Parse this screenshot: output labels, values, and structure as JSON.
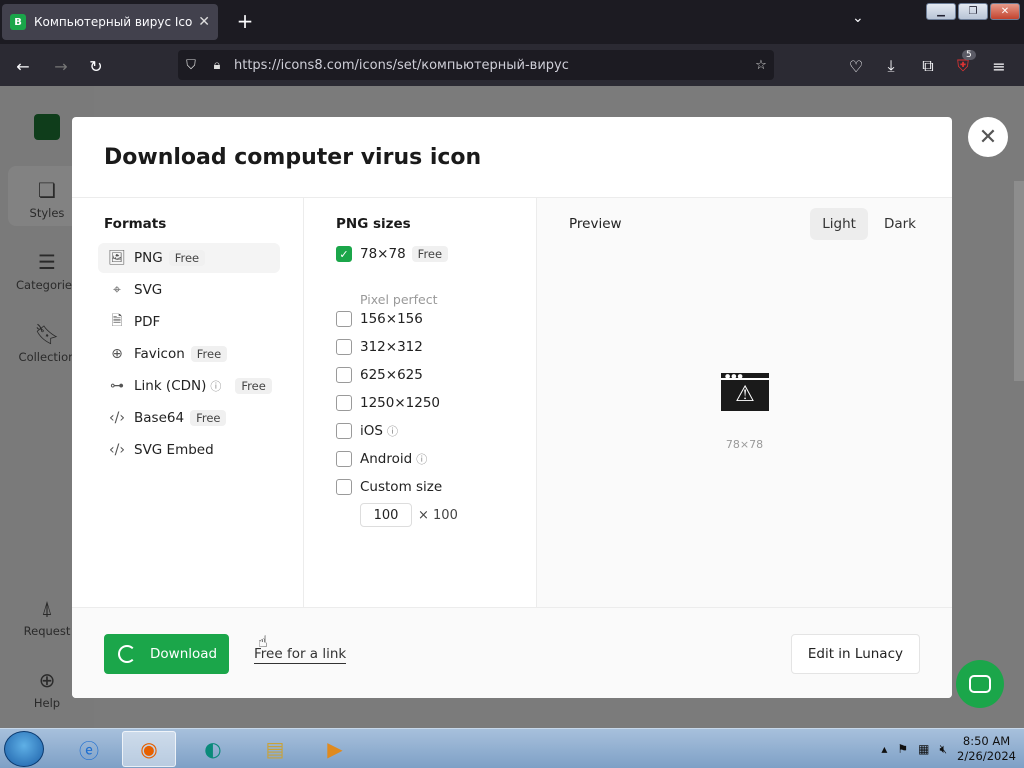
{
  "browser": {
    "tab_title": "Компьютерный вирус Icons, L",
    "tab_favicon": "B",
    "url": "https://icons8.com/icons/set/компьютерный-вирус",
    "extension_badge": "5"
  },
  "sidebar": {
    "items": [
      {
        "label": "Styles",
        "icon": "styles-icon"
      },
      {
        "label": "Categories",
        "icon": "categories-icon"
      },
      {
        "label": "Collection",
        "icon": "collection-icon"
      },
      {
        "label": "Request",
        "icon": "request-icon"
      },
      {
        "label": "Help",
        "icon": "help-icon"
      }
    ]
  },
  "modal": {
    "title": "Download computer virus icon",
    "formats_heading": "Formats",
    "formats": [
      {
        "label": "PNG",
        "free": "Free",
        "icon": "image-icon",
        "active": true
      },
      {
        "label": "SVG",
        "free": "",
        "icon": "vector-icon"
      },
      {
        "label": "PDF",
        "free": "",
        "icon": "pdf-icon"
      },
      {
        "label": "Favicon",
        "free": "Free",
        "icon": "globe-icon"
      },
      {
        "label": "Link (CDN)",
        "free": "Free",
        "icon": "link-icon",
        "info": "ⓘ"
      },
      {
        "label": "Base64",
        "free": "Free",
        "icon": "code-icon"
      },
      {
        "label": "SVG Embed",
        "free": "",
        "icon": "code-icon"
      }
    ],
    "sizes_heading": "PNG sizes",
    "sizes": [
      {
        "label": "78×78",
        "free": "Free",
        "checked": true,
        "note": "Pixel perfect"
      },
      {
        "label": "156×156",
        "checked": false
      },
      {
        "label": "312×312",
        "checked": false
      },
      {
        "label": "625×625",
        "checked": false
      },
      {
        "label": "1250×1250",
        "checked": false
      },
      {
        "label": "iOS",
        "checked": false,
        "info": "ⓘ"
      },
      {
        "label": "Android",
        "checked": false,
        "info": "ⓘ"
      },
      {
        "label": "Custom size",
        "checked": false
      }
    ],
    "custom_width": "100",
    "custom_height_text": "× 100",
    "preview_heading": "Preview",
    "theme_light": "Light",
    "theme_dark": "Dark",
    "preview_size": "78×78",
    "download_label": "Download",
    "free_link_label": "Free for a link",
    "lunacy_label": "Edit in Lunacy"
  },
  "taskbar": {
    "time": "8:50 AM",
    "date": "2/26/2024"
  },
  "colors": {
    "accent": "#1ba64a",
    "overlay": "#7b7b7b"
  }
}
